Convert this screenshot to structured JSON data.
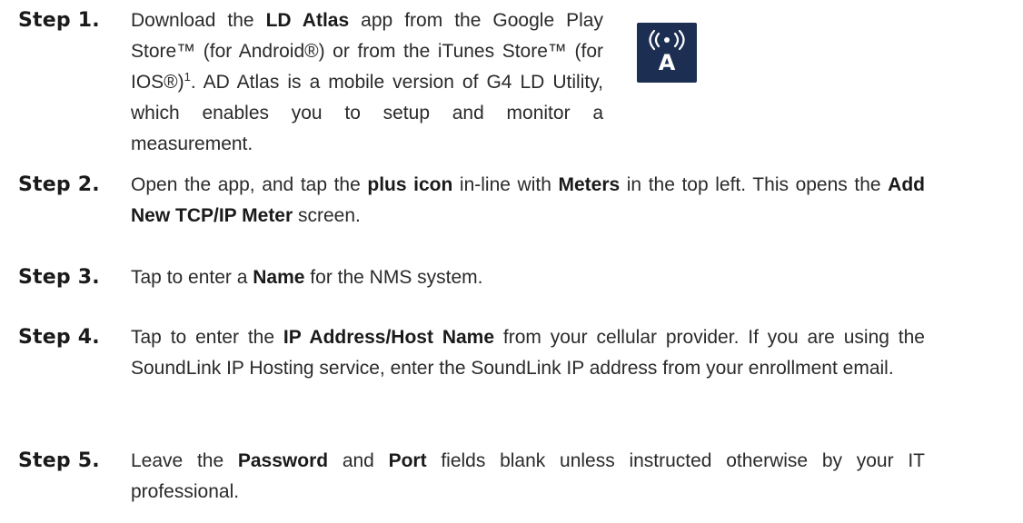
{
  "steps": [
    {
      "label": "Step 1.",
      "segments": [
        {
          "text": "Download the ",
          "bold": false
        },
        {
          "text": "LD Atlas",
          "bold": true
        },
        {
          "text": " app from the Google Play Store™ (for Android®) or from the iTunes Store™ (for IOS®)",
          "bold": false
        },
        {
          "text": "1",
          "sup": true
        },
        {
          "text": ". AD Atlas is a mobile version of G4 LD Utility, which enables you to setup and monitor a measurement.",
          "bold": false
        }
      ]
    },
    {
      "label": "Step 2.",
      "segments": [
        {
          "text": "Open the app, and tap the ",
          "bold": false
        },
        {
          "text": "plus icon",
          "bold": true
        },
        {
          "text": " in-line with ",
          "bold": false
        },
        {
          "text": "Meters",
          "bold": true
        },
        {
          "text": " in the top left. This opens the ",
          "bold": false
        },
        {
          "text": "Add New TCP/IP Meter",
          "bold": true
        },
        {
          "text": " screen.",
          "bold": false
        }
      ]
    },
    {
      "label": "Step 3.",
      "segments": [
        {
          "text": "Tap to enter a ",
          "bold": false
        },
        {
          "text": "Name",
          "bold": true
        },
        {
          "text": " for the NMS system.",
          "bold": false
        }
      ]
    },
    {
      "label": "Step 4.",
      "segments": [
        {
          "text": "Tap to enter the ",
          "bold": false
        },
        {
          "text": "IP Address/Host Name",
          "bold": true
        },
        {
          "text": " from your cellular provider. If you are using the SoundLink IP Hosting service, enter the SoundLink IP address from your enrollment email.",
          "bold": false
        }
      ]
    },
    {
      "label": "Step 5.",
      "segments": [
        {
          "text": "Leave the ",
          "bold": false
        },
        {
          "text": "Password",
          "bold": true
        },
        {
          "text": " and ",
          "bold": false
        },
        {
          "text": "Port",
          "bold": true
        },
        {
          "text": " fields blank unless instructed otherwise by your IT professional.",
          "bold": false
        }
      ]
    }
  ],
  "app_icon": {
    "icon": "ld-atlas-app-icon",
    "glyph_letter": "A",
    "background": "#1c2e52",
    "foreground": "#ffffff"
  }
}
